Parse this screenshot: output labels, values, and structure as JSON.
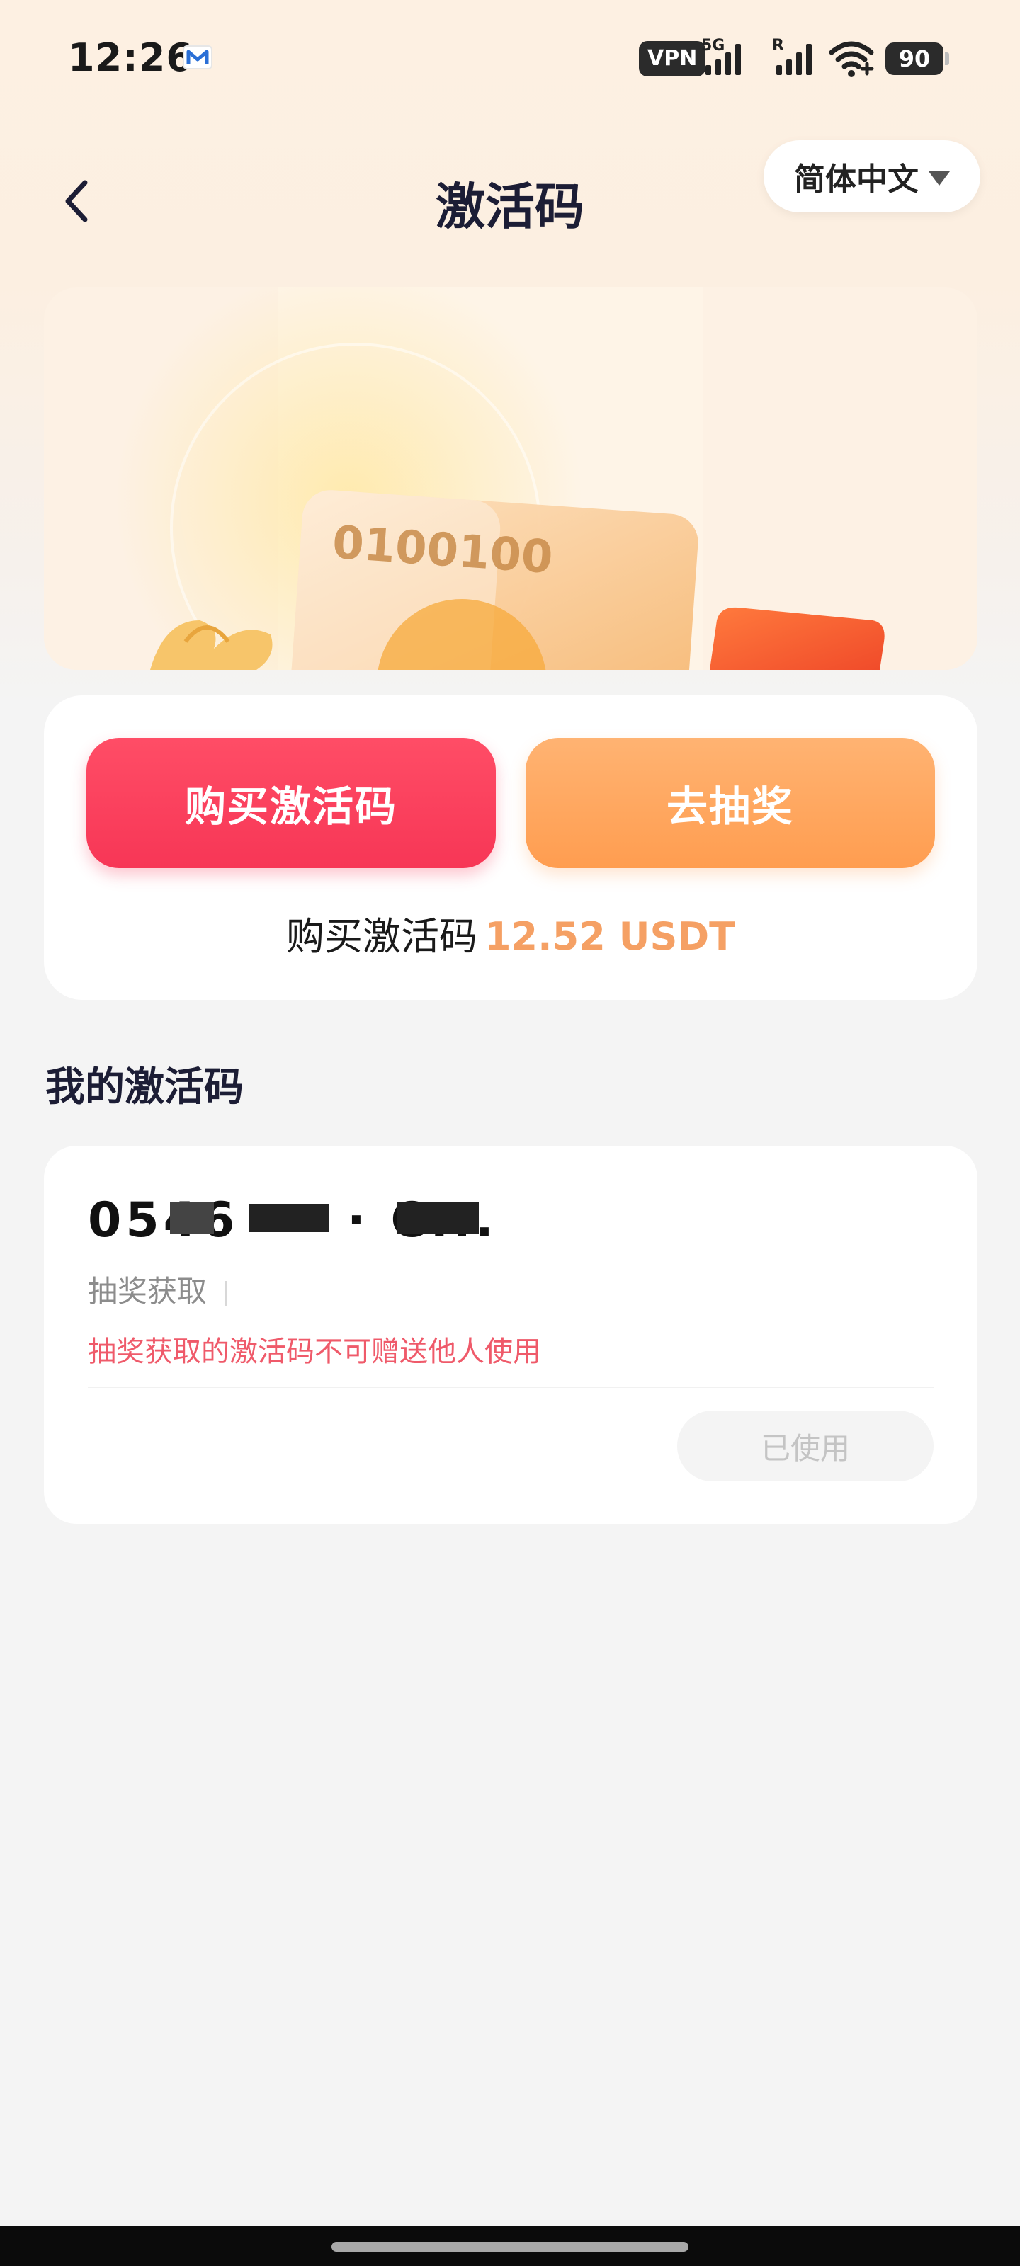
{
  "status_bar": {
    "time": "12:26",
    "vpn": "VPN",
    "sig1_label": "5G",
    "sig2_label": "R",
    "battery": "90"
  },
  "header": {
    "title": "激活码",
    "language": "简体中文"
  },
  "banner": {
    "card_digits": "0100100"
  },
  "actions": {
    "buy_label": "购买激活码",
    "draw_label": "去抽奖",
    "price_prefix": "购买激活码",
    "price_value": "12.52 USDT"
  },
  "my_codes": {
    "section_title": "我的激活码",
    "items": [
      {
        "code": "0546 · · · C...",
        "source": "抽奖获取",
        "warning": "抽奖获取的激活码不可赠送他人使用",
        "status": "已使用"
      }
    ]
  },
  "colors": {
    "buy": "#f73656",
    "draw": "#ff9d50",
    "price": "#f5a064",
    "warning": "#ef5a6a"
  },
  "icons": [
    "mail-icon",
    "signal-icon",
    "wifi-icon",
    "back-arrow-icon",
    "chevron-down-icon"
  ]
}
